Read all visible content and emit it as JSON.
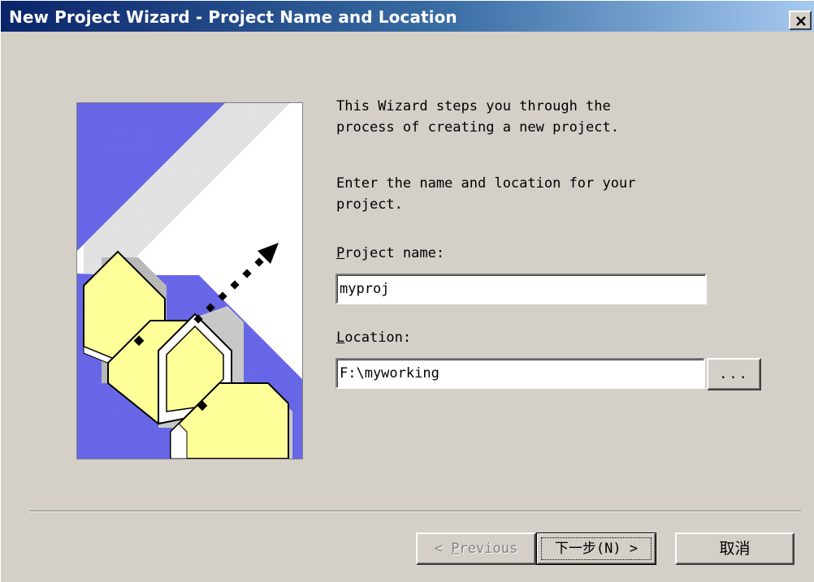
{
  "window": {
    "title": "New Project Wizard - Project Name and Location"
  },
  "intro": {
    "line1": "This Wizard steps you through the",
    "line2": "process of creating a new project.",
    "line3": "Enter the name and location for your",
    "line4": "project."
  },
  "project_name": {
    "label_underlined": "P",
    "label_rest": "roject name:",
    "value": "myproj"
  },
  "location": {
    "label_underlined": "L",
    "label_rest": "ocation:",
    "value": "F:\\myworking",
    "browse_label": "..."
  },
  "buttons": {
    "previous_prefix": "< ",
    "previous_underlined": "P",
    "previous_rest": "revious",
    "next_label": "下一步(N) >",
    "cancel_label": "取消"
  },
  "colors": {
    "dialog_bg": "#d4d0c8",
    "titlebar_start": "#0a246a",
    "titlebar_end": "#a6caf0",
    "art_blue": "#6f6fdf",
    "art_yellow": "#ffff99"
  },
  "icons": {
    "close": "close-icon",
    "illustration": "wizard-folder-illustration"
  }
}
